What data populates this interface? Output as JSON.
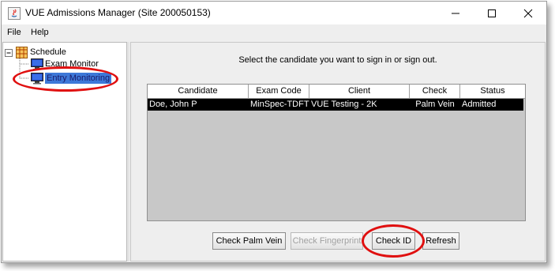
{
  "window": {
    "title": "VUE Admissions Manager (Site 200050153)",
    "controls": [
      "minimize-icon",
      "maximize-icon",
      "close-icon"
    ]
  },
  "menu": {
    "items": [
      "File",
      "Help"
    ]
  },
  "tree": {
    "root": {
      "label": "Schedule",
      "expander": "⊟",
      "icon": "schedule-grid-icon"
    },
    "items": [
      {
        "label": "Exam Monitor",
        "icon": "monitor-icon",
        "selected": false
      },
      {
        "label": "Entry Monitoring",
        "icon": "monitor-icon",
        "selected": true
      }
    ]
  },
  "main": {
    "instruction": "Select the candidate you want to sign in or sign out.",
    "table": {
      "columns": [
        "Candidate",
        "Exam Code",
        "Client",
        "Check",
        "Status"
      ],
      "rows": [
        {
          "candidate": "Doe, John P",
          "exam_code": "MinSpec-TDFT",
          "client": "VUE Testing - 2K",
          "check": "Palm Vein",
          "status": "Admitted",
          "selected": true
        }
      ]
    },
    "buttons": {
      "check_palm_vein": "Check Palm Vein",
      "check_fingerprint": "Check Fingerprint",
      "check_id": "Check ID",
      "refresh": "Refresh"
    }
  },
  "colors": {
    "selection": "#3d78d8",
    "row_selected_bg": "#000000",
    "callout": "#e01010"
  }
}
